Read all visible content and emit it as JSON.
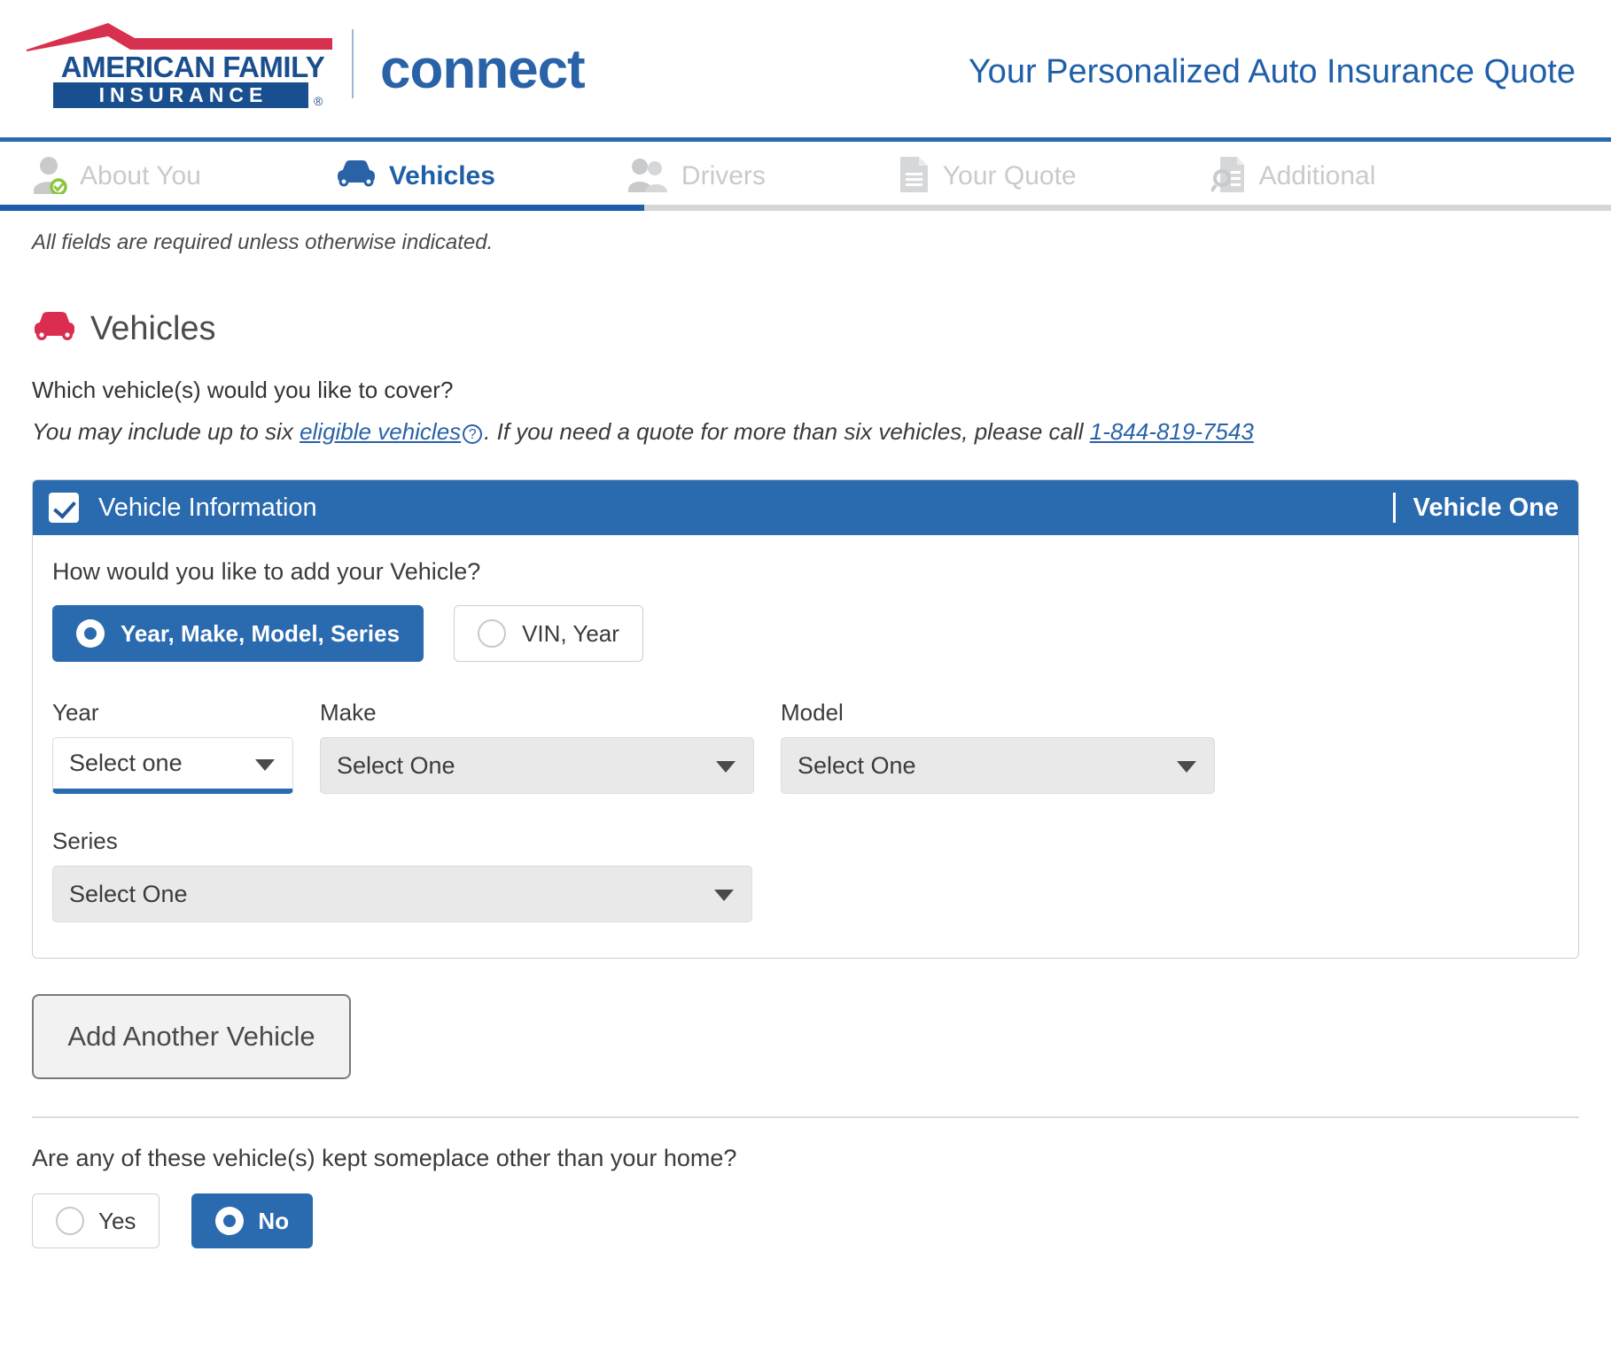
{
  "brand": {
    "company_line1": "AMERICAN FAMILY",
    "company_line2": "INSURANCE",
    "registered_mark": "®",
    "product": "connect",
    "roof_color": "#d8314f",
    "logo_blue": "#1a4f8f"
  },
  "header": {
    "title": "Your Personalized Auto Insurance Quote",
    "title_color": "#1f5fa9"
  },
  "tabs": [
    {
      "label": "About You",
      "icon": "person-icon",
      "state": "completed",
      "badge": "check-badge-icon"
    },
    {
      "label": "Vehicles",
      "icon": "car-icon",
      "state": "active"
    },
    {
      "label": "Drivers",
      "icon": "people-icon",
      "state": "upcoming"
    },
    {
      "label": "Your Quote",
      "icon": "document-icon",
      "state": "upcoming"
    },
    {
      "label": "Additional",
      "icon": "document-search-icon",
      "state": "upcoming"
    }
  ],
  "notes": {
    "required_fields": "All fields are required unless otherwise indicated."
  },
  "section": {
    "icon": "car-icon",
    "title": "Vehicles",
    "accent_color": "#da2d4f",
    "question": "Which vehicle(s) would you like to cover?",
    "subnote_part1": "You may include up to six ",
    "subnote_link": "eligible vehicles",
    "subnote_help_icon": "?",
    "subnote_part2": ". If you need a quote for more than six vehicles, please call ",
    "phone": "1-844-819-7543"
  },
  "vehicle_card": {
    "checkbox_state": "checked",
    "header_title": "Vehicle Information",
    "header_badge": "Vehicle One",
    "header_color": "#2a6bb0",
    "add_method_question": "How would you like to add your Vehicle?",
    "add_method_options": [
      {
        "label": "Year, Make, Model, Series",
        "selected": true
      },
      {
        "label": "VIN, Year",
        "selected": false
      }
    ],
    "fields": [
      {
        "label": "Year",
        "value": "Select one",
        "state": "focused"
      },
      {
        "label": "Make",
        "value": "Select One",
        "state": "default"
      },
      {
        "label": "Model",
        "value": "Select One",
        "state": "default"
      },
      {
        "label": "Series",
        "value": "Select One",
        "state": "default"
      }
    ]
  },
  "actions": {
    "add_another_vehicle": "Add Another Vehicle"
  },
  "garaging": {
    "question": "Are any of these vehicle(s) kept someplace other than your home?",
    "options": [
      {
        "label": "Yes",
        "selected": false
      },
      {
        "label": "No",
        "selected": true
      }
    ]
  }
}
